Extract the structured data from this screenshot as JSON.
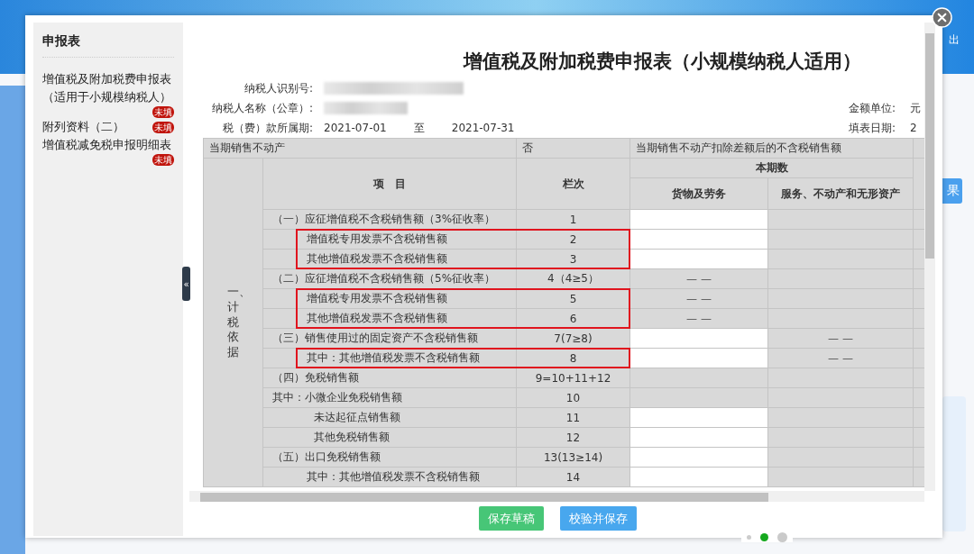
{
  "background": {
    "header_text": "出",
    "button_label": "果"
  },
  "dialog": {
    "sidebar": {
      "title": "申报表",
      "items": [
        {
          "label": "增值税及附加税费申报表（适用于小规模纳税人）",
          "badge": "未填",
          "selected": false
        },
        {
          "label": "附列资料（二）",
          "badge": "未填",
          "selected": false
        },
        {
          "label": "增值税减免税申报明细表",
          "badge": "未填",
          "selected": false
        }
      ],
      "collapse_glyph": "«"
    },
    "form": {
      "title": "增值税及附加税费申报表（小规模纳税人适用）",
      "fields": [
        {
          "label": "纳税人识别号:",
          "kind": "blurred"
        },
        {
          "label": "纳税人名称（公章）:",
          "kind": "blurred"
        },
        {
          "label": "税（费）款所属期:",
          "kind": "period",
          "from": "2021-07-01",
          "separator": "至",
          "to": "2021-07-31"
        }
      ],
      "right_fields": [
        {
          "label": "金额单位:",
          "value": "元"
        },
        {
          "label": "填表日期:",
          "value": "2"
        }
      ],
      "top_row": [
        "当期销售不动产",
        "否",
        "当期销售不动产扣除差额后的不含税销售额"
      ],
      "section_label": "一、计税依据",
      "columns": {
        "item": "项　目",
        "line": "栏次",
        "group": "本期数",
        "goods": "货物及劳务",
        "services": "服务、不动产和无形资产"
      },
      "rows": [
        {
          "item": "（一）应征增值税不含税销售额（3%征收率）",
          "kind": "main",
          "line": "1",
          "goods_editable": true,
          "highlighted": false
        },
        {
          "item": "增值税专用发票不含税销售额",
          "kind": "sub",
          "line": "2",
          "goods_editable": true,
          "highlighted": true
        },
        {
          "item": "其他增值税发票不含税销售额",
          "kind": "sub",
          "line": "3",
          "goods_editable": true,
          "highlighted": true
        },
        {
          "item": "（二）应征增值税不含税销售额（5%征收率）",
          "kind": "main",
          "line": "4（4≥5）",
          "goods_editable": false,
          "goods_text": "— —",
          "highlighted": false
        },
        {
          "item": "增值税专用发票不含税销售额",
          "kind": "sub",
          "line": "5",
          "goods_editable": false,
          "goods_text": "— —",
          "highlighted": true
        },
        {
          "item": "其他增值税发票不含税销售额",
          "kind": "sub",
          "line": "6",
          "goods_editable": false,
          "goods_text": "— —",
          "highlighted": true
        },
        {
          "item": "（三）销售使用过的固定资产不含税销售额",
          "kind": "main",
          "line": "7(7≥8)",
          "goods_editable": true,
          "services_text": "— —",
          "highlighted": false
        },
        {
          "item": "其中：其他增值税发票不含税销售额",
          "kind": "sub",
          "line": "8",
          "goods_editable": true,
          "services_text": "— —",
          "highlighted": true
        },
        {
          "item": "（四）免税销售额",
          "kind": "main",
          "line": "9=10+11+12",
          "goods_editable": false,
          "highlighted": false
        },
        {
          "item": "其中：小微企业免税销售额",
          "kind": "main",
          "line": "10",
          "goods_editable": false,
          "highlighted": false
        },
        {
          "item": "未达起征点销售额",
          "kind": "detail",
          "line": "11",
          "goods_editable": true,
          "highlighted": false
        },
        {
          "item": "其他免税销售额",
          "kind": "detail",
          "line": "12",
          "goods_editable": true,
          "highlighted": false
        },
        {
          "item": "（五）出口免税销售额",
          "kind": "main",
          "line": "13(13≥14)",
          "goods_editable": true,
          "highlighted": false
        },
        {
          "item": "其中：其他增值税发票不含税销售额",
          "kind": "sub",
          "line": "14",
          "goods_editable": true,
          "highlighted": false
        }
      ]
    },
    "buttons": [
      {
        "label": "保存草稿",
        "kind": "secondary"
      },
      {
        "label": "校验并保存",
        "kind": "primary"
      }
    ]
  },
  "pager": [
    {
      "selected": false
    },
    {
      "selected": true
    },
    {
      "selected": false
    }
  ]
}
